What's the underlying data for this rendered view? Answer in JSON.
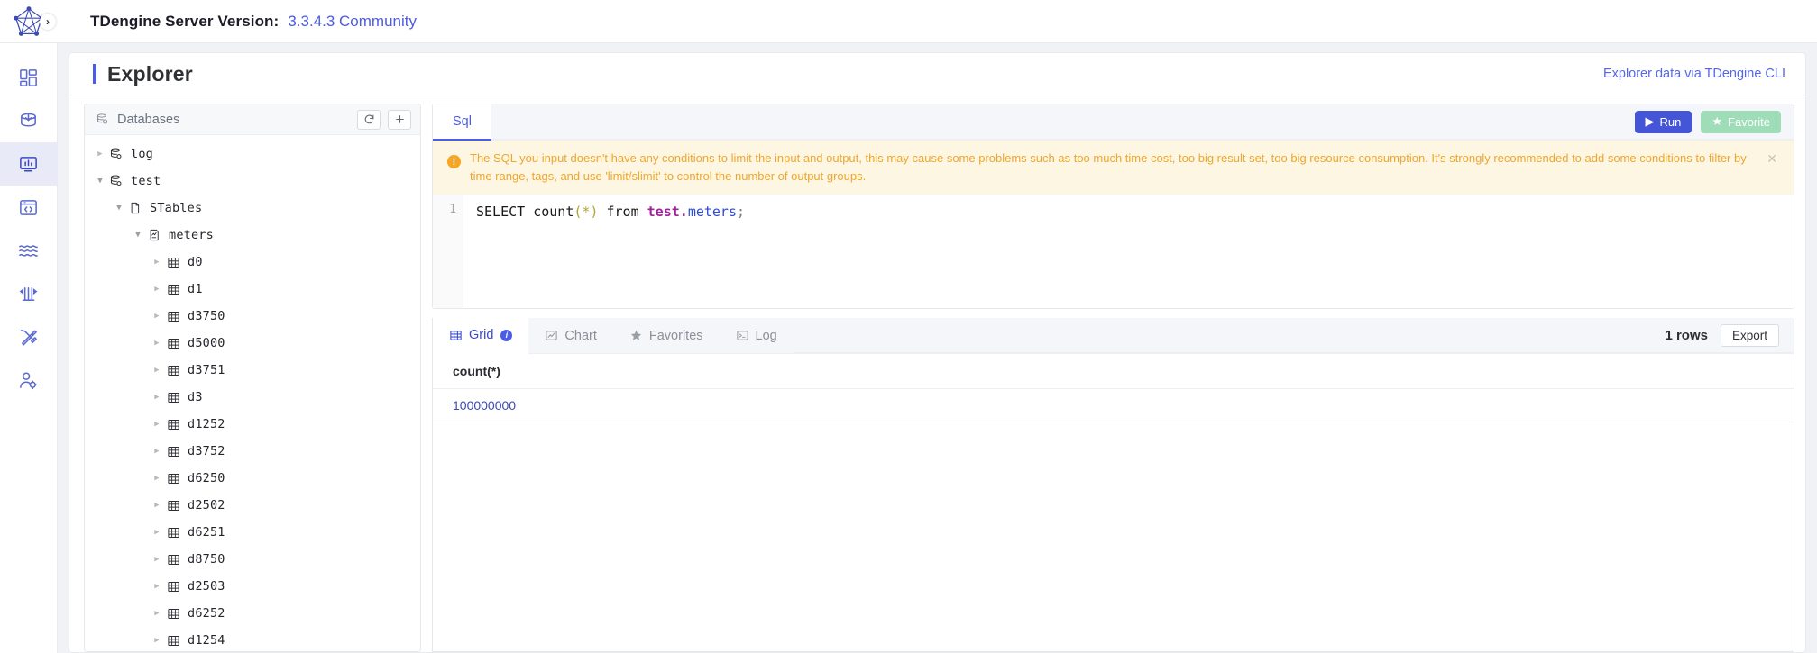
{
  "topbar": {
    "logo_icon": "tdengine-pentagon-logo",
    "expand_icon": "chevron-right-icon",
    "version_label": "TDengine Server Version:",
    "version_value": "3.3.4.3 Community"
  },
  "rail": {
    "items": [
      {
        "name": "sidebar-item-dashboard",
        "icon": "dashboard-grid-icon",
        "active": false
      },
      {
        "name": "sidebar-item-data-in",
        "icon": "database-import-icon",
        "active": false
      },
      {
        "name": "sidebar-item-explorer",
        "icon": "monitor-chart-icon",
        "active": true
      },
      {
        "name": "sidebar-item-programming",
        "icon": "code-browser-icon",
        "active": false
      },
      {
        "name": "sidebar-item-stream",
        "icon": "waves-icon",
        "active": false
      },
      {
        "name": "sidebar-item-data-out",
        "icon": "bars-export-icon",
        "active": false
      },
      {
        "name": "sidebar-item-tools",
        "icon": "tools-wrench-screwdriver-icon",
        "active": false
      },
      {
        "name": "sidebar-item-user-management",
        "icon": "user-gear-icon",
        "active": false
      }
    ]
  },
  "page": {
    "title": "Explorer",
    "cli_link": "Explorer data via TDengine CLI"
  },
  "databases_panel": {
    "icon": "database-icon",
    "title": "Databases",
    "refresh_icon": "refresh-icon",
    "add_icon": "plus-icon",
    "tree": [
      {
        "label": "log",
        "icon": "database-icon",
        "depth": 0,
        "caret": "collapsed"
      },
      {
        "label": "test",
        "icon": "database-icon",
        "depth": 0,
        "caret": "expanded"
      },
      {
        "label": "STables",
        "icon": "stable-folder-icon",
        "depth": 1,
        "caret": "expanded"
      },
      {
        "label": "meters",
        "icon": "stable-icon",
        "depth": 2,
        "caret": "expanded"
      },
      {
        "label": "d0",
        "icon": "table-icon",
        "depth": 3,
        "caret": "collapsed"
      },
      {
        "label": "d1",
        "icon": "table-icon",
        "depth": 3,
        "caret": "collapsed"
      },
      {
        "label": "d3750",
        "icon": "table-icon",
        "depth": 3,
        "caret": "collapsed"
      },
      {
        "label": "d5000",
        "icon": "table-icon",
        "depth": 3,
        "caret": "collapsed"
      },
      {
        "label": "d3751",
        "icon": "table-icon",
        "depth": 3,
        "caret": "collapsed"
      },
      {
        "label": "d3",
        "icon": "table-icon",
        "depth": 3,
        "caret": "collapsed"
      },
      {
        "label": "d1252",
        "icon": "table-icon",
        "depth": 3,
        "caret": "collapsed"
      },
      {
        "label": "d3752",
        "icon": "table-icon",
        "depth": 3,
        "caret": "collapsed"
      },
      {
        "label": "d6250",
        "icon": "table-icon",
        "depth": 3,
        "caret": "collapsed"
      },
      {
        "label": "d2502",
        "icon": "table-icon",
        "depth": 3,
        "caret": "collapsed"
      },
      {
        "label": "d6251",
        "icon": "table-icon",
        "depth": 3,
        "caret": "collapsed"
      },
      {
        "label": "d8750",
        "icon": "table-icon",
        "depth": 3,
        "caret": "collapsed"
      },
      {
        "label": "d2503",
        "icon": "table-icon",
        "depth": 3,
        "caret": "collapsed"
      },
      {
        "label": "d6252",
        "icon": "table-icon",
        "depth": 3,
        "caret": "collapsed"
      },
      {
        "label": "d1254",
        "icon": "table-icon",
        "depth": 3,
        "caret": "collapsed"
      }
    ]
  },
  "sql_panel": {
    "tab_label": "Sql",
    "run_label": "Run",
    "run_icon": "play-icon",
    "favorite_label": "Favorite",
    "favorite_icon": "star-icon",
    "warning": {
      "icon": "warning-exclamation-icon",
      "text": "The SQL you input doesn't have any conditions to limit the input and output, this may cause some problems such as too much time cost, too big result set, too big resource consumption. It's strongly recommended to add some conditions to filter by time range, tags, and use 'limit/slimit' to control the number of output groups.",
      "close_icon": "close-icon"
    },
    "editor": {
      "line_number": "1",
      "tokens": [
        {
          "text": "SELECT",
          "type": "keyword"
        },
        {
          "text": " count",
          "type": "function"
        },
        {
          "text": "(*)",
          "type": "star"
        },
        {
          "text": " from ",
          "type": "keyword"
        },
        {
          "text": "test.",
          "type": "db"
        },
        {
          "text": "meters",
          "type": "table"
        },
        {
          "text": ";",
          "type": "semicolon"
        }
      ]
    }
  },
  "results_panel": {
    "tabs": [
      {
        "label": "Grid",
        "icon": "grid-icon",
        "active": true,
        "badge": "i"
      },
      {
        "label": "Chart",
        "icon": "line-chart-icon",
        "active": false
      },
      {
        "label": "Favorites",
        "icon": "star-icon",
        "active": false
      },
      {
        "label": "Log",
        "icon": "terminal-icon",
        "active": false
      }
    ],
    "rows_count": "1 rows",
    "export_label": "Export",
    "grid": {
      "columns": [
        "count(*)"
      ],
      "rows": [
        [
          "100000000"
        ]
      ]
    }
  },
  "colors": {
    "accent": "#4b5ce6",
    "warning_bg": "#fdf6e3",
    "warning_text": "#f0a62c",
    "run_button": "#4455d8",
    "favorite_button": "#9fdcb8",
    "rail_active_bg": "#e9eaf8",
    "link": "#5566e8"
  }
}
